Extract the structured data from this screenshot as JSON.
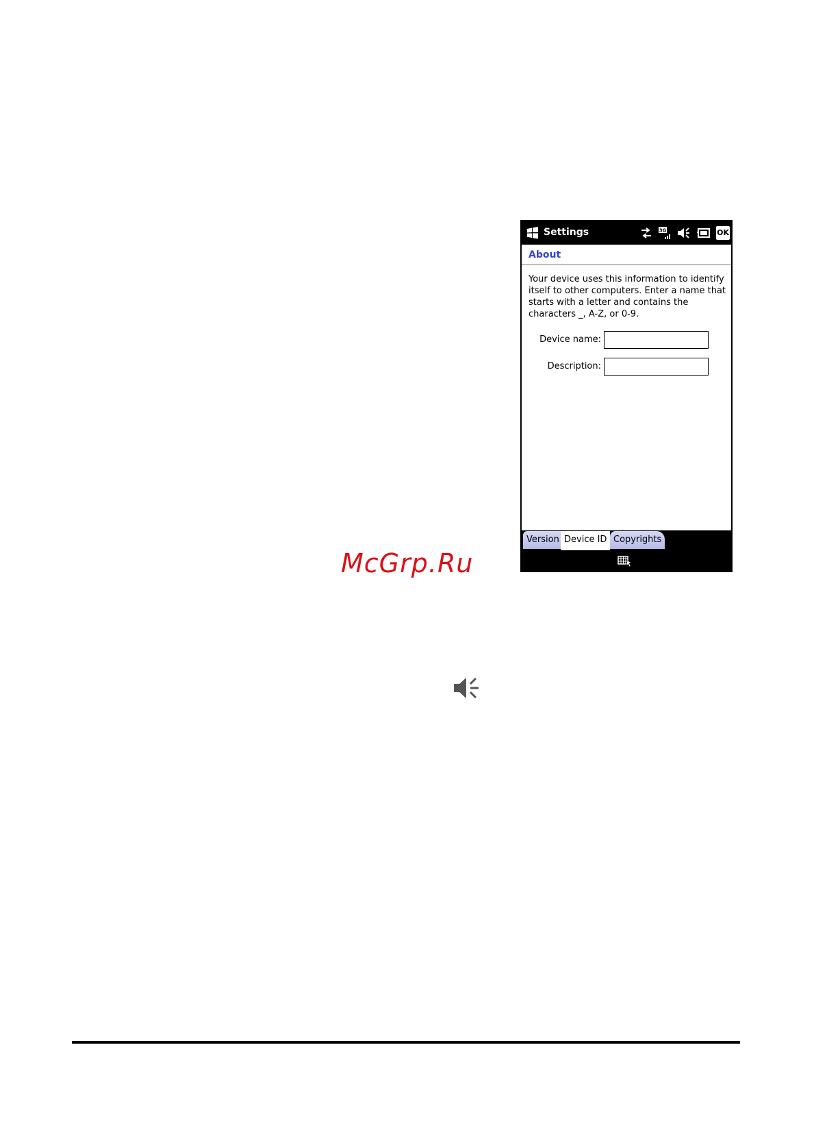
{
  "window": {
    "title": "Settings",
    "ok_label": "OK"
  },
  "status_icons": [
    "connectivity-icon",
    "3g-signal-icon",
    "volume-icon",
    "battery-icon"
  ],
  "status_3g_label": "3G",
  "page": {
    "heading": "About",
    "description": "Your device uses this information to identify itself to other computers. Enter a name that starts with a letter and contains the characters _, A-Z, or 0-9."
  },
  "form": {
    "device_name": {
      "label": "Device name:",
      "value": ""
    },
    "description": {
      "label": "Description:",
      "value": ""
    }
  },
  "tabs": [
    {
      "label": "Version",
      "active": false
    },
    {
      "label": "Device ID",
      "active": true
    },
    {
      "label": "Copyrights",
      "active": false
    }
  ],
  "menubar": {
    "icon": "keyboard-icon"
  },
  "watermark": "McGrp.Ru",
  "colors": {
    "heading": "#3344cc",
    "tab_inactive": "#c4c7ee",
    "watermark": "#d9121a"
  }
}
